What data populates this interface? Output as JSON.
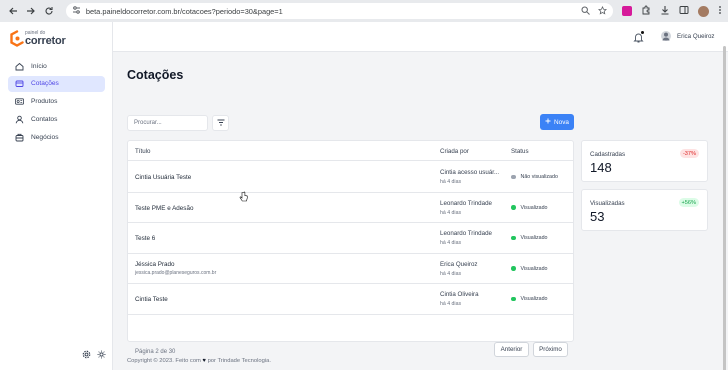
{
  "browser": {
    "url": "beta.paineldocorretor.com.br/cotacoes?periodo=30&page=1"
  },
  "logo": {
    "small": "painel do",
    "big": "corretor"
  },
  "sidebar": {
    "items": [
      {
        "label": "Início",
        "icon": "home-icon",
        "active": false
      },
      {
        "label": "Cotações",
        "icon": "quotes-icon",
        "active": true
      },
      {
        "label": "Produtos",
        "icon": "products-icon",
        "active": false
      },
      {
        "label": "Contatos",
        "icon": "contacts-icon",
        "active": false
      },
      {
        "label": "Negócios",
        "icon": "business-icon",
        "active": false
      }
    ]
  },
  "topbar": {
    "user_name": "Erica Queiroz"
  },
  "page": {
    "title": "Cotações",
    "search_placeholder": "Procurar...",
    "new_button": "Nova"
  },
  "table": {
    "columns": {
      "title": "Título",
      "created_by": "Criada por",
      "status": "Status"
    },
    "rows": [
      {
        "title": "Cintia Usuária Teste",
        "subtitle": "",
        "creator": "Cintia acesso usuár...",
        "ago": "há 4 dias",
        "status": "Não visualizado",
        "status_color": "#9ca3af"
      },
      {
        "title": "Teste PME e Adesão",
        "subtitle": "",
        "creator": "Leonardo Trindade",
        "ago": "há 4 dias",
        "status": "Visualizado",
        "status_color": "#22c55e"
      },
      {
        "title": "Teste 6",
        "subtitle": "",
        "creator": "Leonardo Trindade",
        "ago": "há 4 dias",
        "status": "Visualizado",
        "status_color": "#22c55e"
      },
      {
        "title": "Jéssica Prado",
        "subtitle": "jessica.prado@planeseguros.com.br",
        "creator": "Erica Queiroz",
        "ago": "há 4 dias",
        "status": "Visualizado",
        "status_color": "#22c55e"
      },
      {
        "title": "Cintia Teste",
        "subtitle": "",
        "creator": "Cintia Oliveira",
        "ago": "há 4 dias",
        "status": "Visualizado",
        "status_color": "#22c55e"
      }
    ],
    "pagination": {
      "info": "Página 2 de 30",
      "prev": "Anterior",
      "next": "Próximo"
    }
  },
  "stats": [
    {
      "label": "Cadastradas",
      "value": "148",
      "badge": "-37%",
      "badge_bg": "#fee2e2",
      "badge_fg": "#dc2626"
    },
    {
      "label": "Visualizadas",
      "value": "53",
      "badge": "+56%",
      "badge_bg": "#dcfce7",
      "badge_fg": "#16a34a"
    }
  ],
  "footer": {
    "prefix": "Copyright © 2023. Feito com",
    "suffix": "por Trindade Tecnologia."
  },
  "colors": {
    "accent": "#4f46e5",
    "primary_button": "#3b82f6",
    "logo_orange": "#f97316"
  }
}
